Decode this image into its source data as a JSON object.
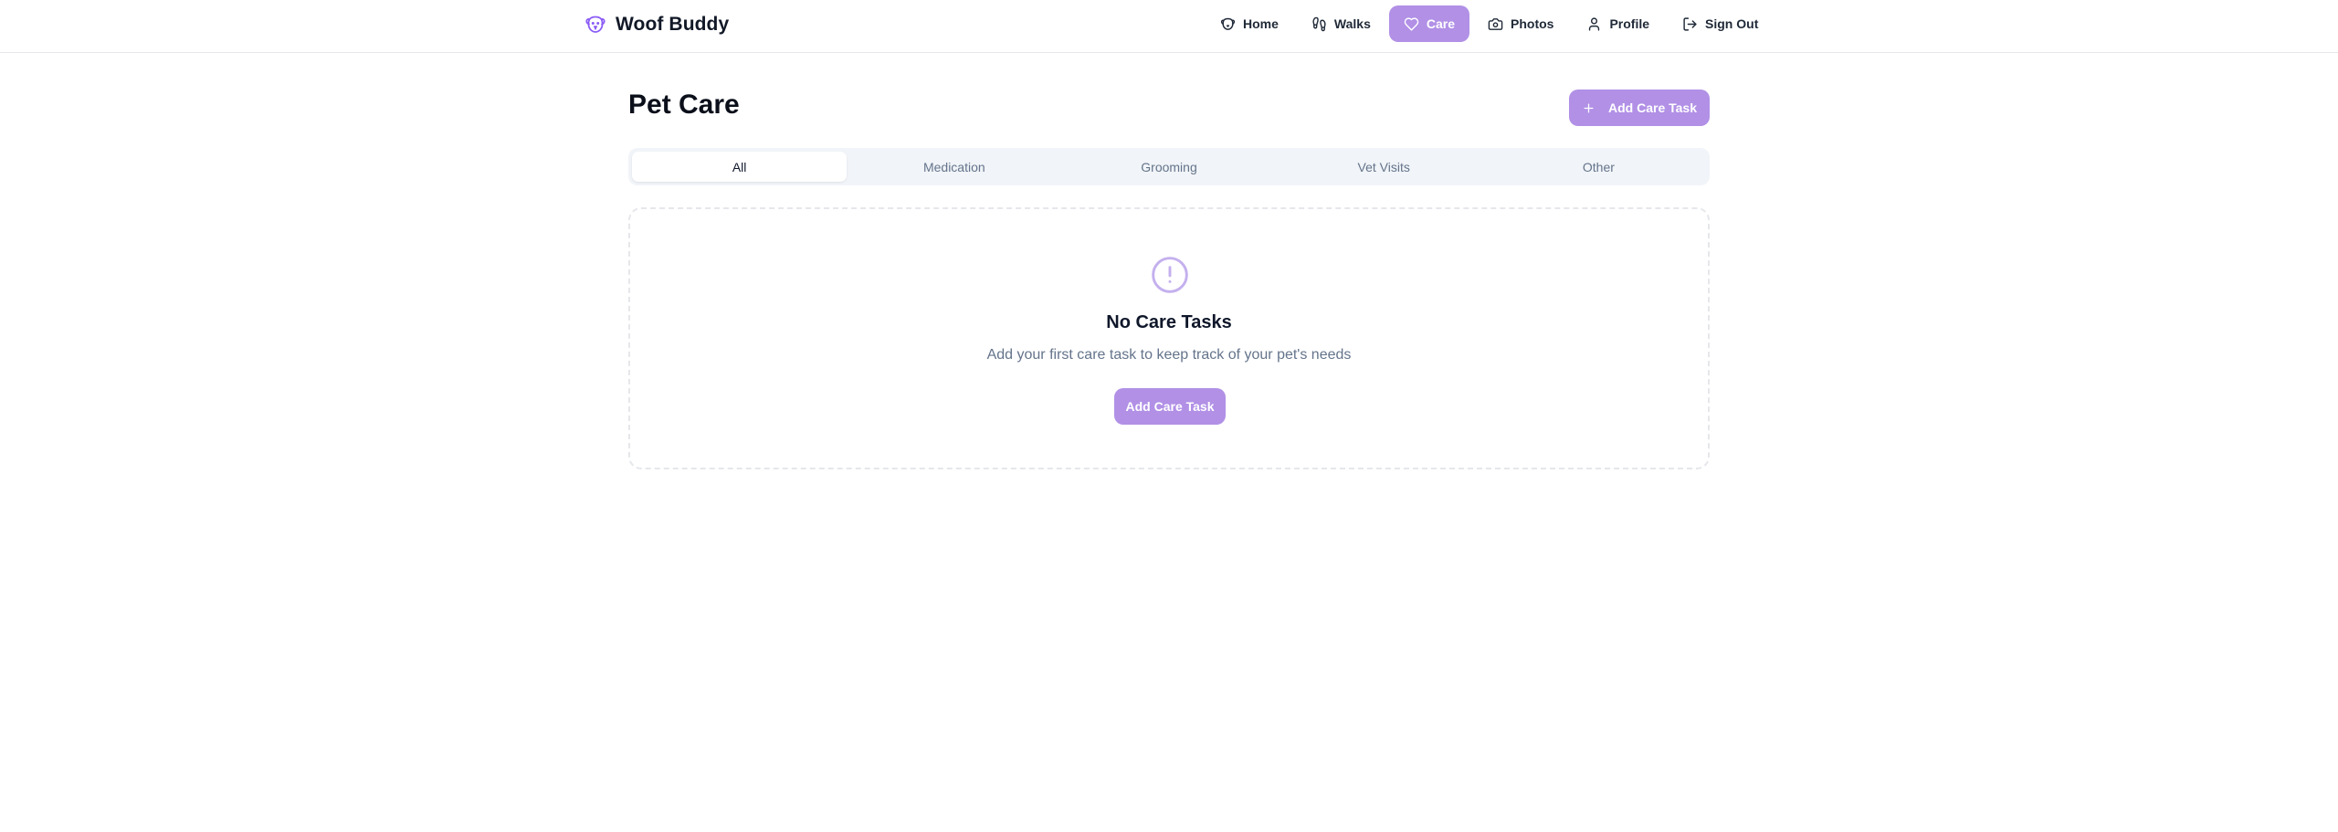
{
  "header": {
    "brand_name": "Woof Buddy",
    "nav": [
      {
        "label": "Home",
        "icon": "dog-icon"
      },
      {
        "label": "Walks",
        "icon": "footprints-icon"
      },
      {
        "label": "Care",
        "icon": "heart-icon",
        "active": true
      },
      {
        "label": "Photos",
        "icon": "camera-icon"
      },
      {
        "label": "Profile",
        "icon": "user-icon"
      },
      {
        "label": "Sign Out",
        "icon": "logout-icon"
      }
    ]
  },
  "main": {
    "title": "Pet Care",
    "add_button_label": "Add Care Task",
    "tabs": [
      {
        "label": "All",
        "active": true
      },
      {
        "label": "Medication"
      },
      {
        "label": "Grooming"
      },
      {
        "label": "Vet Visits"
      },
      {
        "label": "Other"
      }
    ],
    "empty_state": {
      "icon": "alert-circle-icon",
      "title": "No Care Tasks",
      "description": "Add your first care task to keep track of your pet's needs",
      "button_label": "Add Care Task"
    }
  },
  "colors": {
    "accent": "#b190e6",
    "brand_icon": "#8b5cf6",
    "muted_text": "#64748b",
    "tabs_background": "#f1f4f8"
  }
}
